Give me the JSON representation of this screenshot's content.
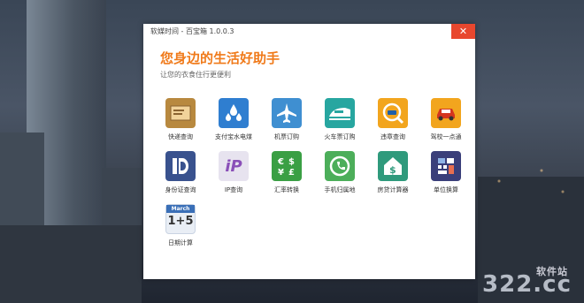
{
  "window": {
    "title": "软媒时间 - 百宝箱 1.0.0.3",
    "heading": "您身边的生活好助手",
    "subheading": "让您的衣食住行更便利"
  },
  "tools": [
    {
      "label": "快递查询",
      "icon": "package-icon",
      "color": "#b8893f"
    },
    {
      "label": "支付宝水电煤",
      "icon": "water-drops-icon",
      "color": "#2f7ed0"
    },
    {
      "label": "机票订购",
      "icon": "airplane-icon",
      "color": "#3f8fd1"
    },
    {
      "label": "火车票订购",
      "icon": "train-icon",
      "color": "#27a6a0"
    },
    {
      "label": "违章查询",
      "icon": "car-search-icon",
      "color": "#f2a51e"
    },
    {
      "label": "驾校一点通",
      "icon": "car-icon",
      "color": "#f2a51e"
    },
    {
      "label": "身份证查询",
      "icon": "id-card-icon",
      "color": "#39528e"
    },
    {
      "label": "IP查询",
      "icon": "ip-icon",
      "color": "#e7e3ef"
    },
    {
      "label": "汇率转换",
      "icon": "currency-exchange-icon",
      "color": "#3a9f44"
    },
    {
      "label": "手机归属地",
      "icon": "phone-search-icon",
      "color": "#4cae5a"
    },
    {
      "label": "房贷计算器",
      "icon": "house-dollar-icon",
      "color": "#2f9a7c"
    },
    {
      "label": "单位换算",
      "icon": "calculator-icon",
      "color": "#3a3f7a"
    },
    {
      "label": "日期计算",
      "icon": "calendar-icon",
      "color": "#e9eef5"
    }
  ],
  "calendar_icon": {
    "month": "March",
    "text": "1+5"
  },
  "close_symbol": "✕",
  "watermark": {
    "main": "322.cc",
    "sub": "软件站"
  }
}
